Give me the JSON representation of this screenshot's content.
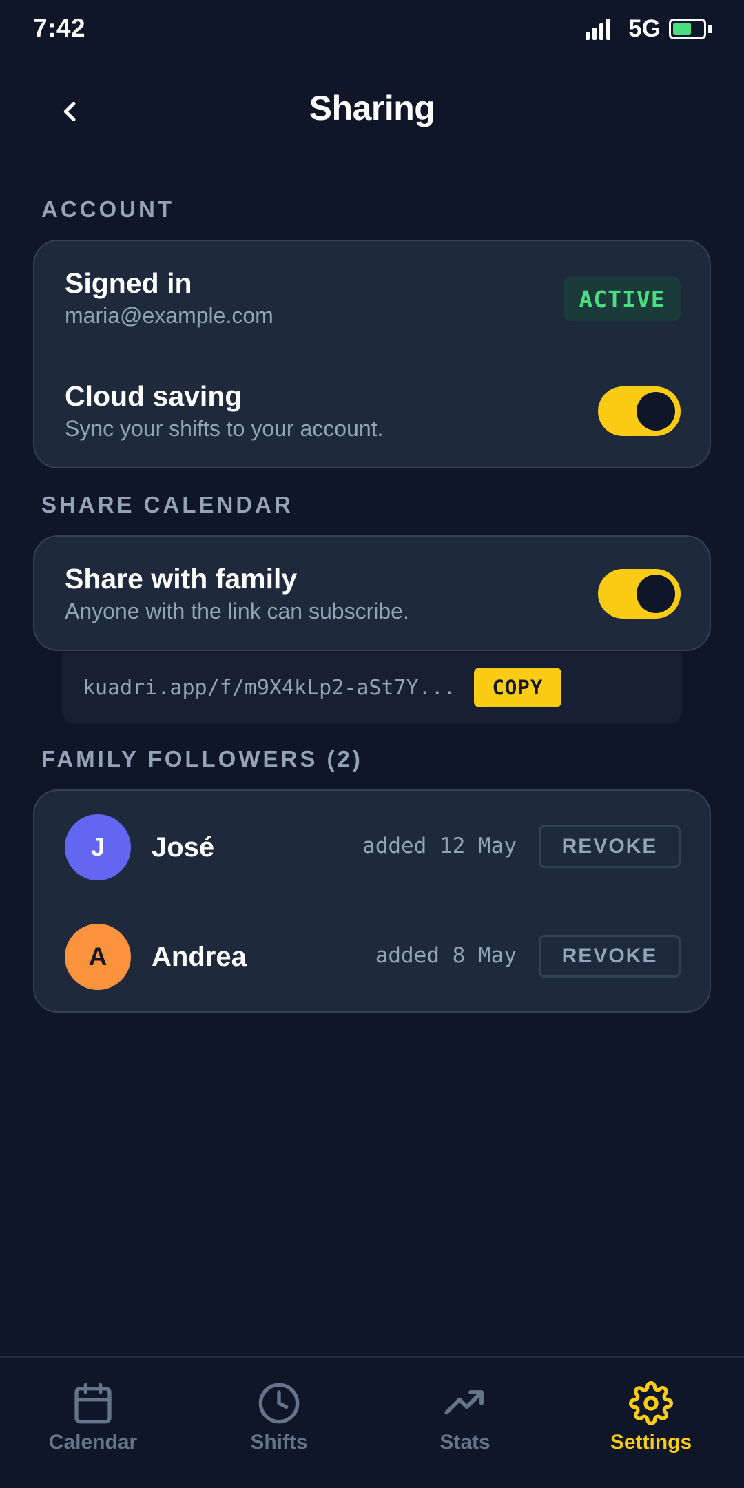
{
  "status_bar": {
    "time": "7:42",
    "network": "5G"
  },
  "header": {
    "title": "Sharing"
  },
  "account": {
    "section_label": "ACCOUNT",
    "signed_in": {
      "title": "Signed in",
      "email": "maria@example.com",
      "badge": "ACTIVE"
    },
    "cloud_saving": {
      "title": "Cloud saving",
      "subtitle": "Sync your shifts to your account.",
      "enabled": true
    }
  },
  "share_calendar": {
    "section_label": "SHARE CALENDAR",
    "share_family": {
      "title": "Share with family",
      "subtitle": "Anyone with the link can subscribe.",
      "enabled": true
    },
    "link": "kuadri.app/f/m9X4kLp2-aSt7Y...",
    "copy_label": "COPY"
  },
  "followers": {
    "section_label": "FAMILY FOLLOWERS (2)",
    "items": [
      {
        "initial": "J",
        "name": "José",
        "added": "added 12 May",
        "revoke_label": "REVOKE",
        "avatar_color": "#6366f1"
      },
      {
        "initial": "A",
        "name": "Andrea",
        "added": "added 8 May",
        "revoke_label": "REVOKE",
        "avatar_color": "#fb923c"
      }
    ]
  },
  "bottom_nav": {
    "items": [
      {
        "label": "Calendar",
        "icon": "calendar-icon"
      },
      {
        "label": "Shifts",
        "icon": "clock-icon"
      },
      {
        "label": "Stats",
        "icon": "trending-up-icon"
      },
      {
        "label": "Settings",
        "icon": "gear-icon",
        "active": true
      }
    ]
  },
  "colors": {
    "background": "#0f1628",
    "card": "#1e293b",
    "accent": "#facc15",
    "success": "#4ade80",
    "muted": "#94a3b8"
  }
}
